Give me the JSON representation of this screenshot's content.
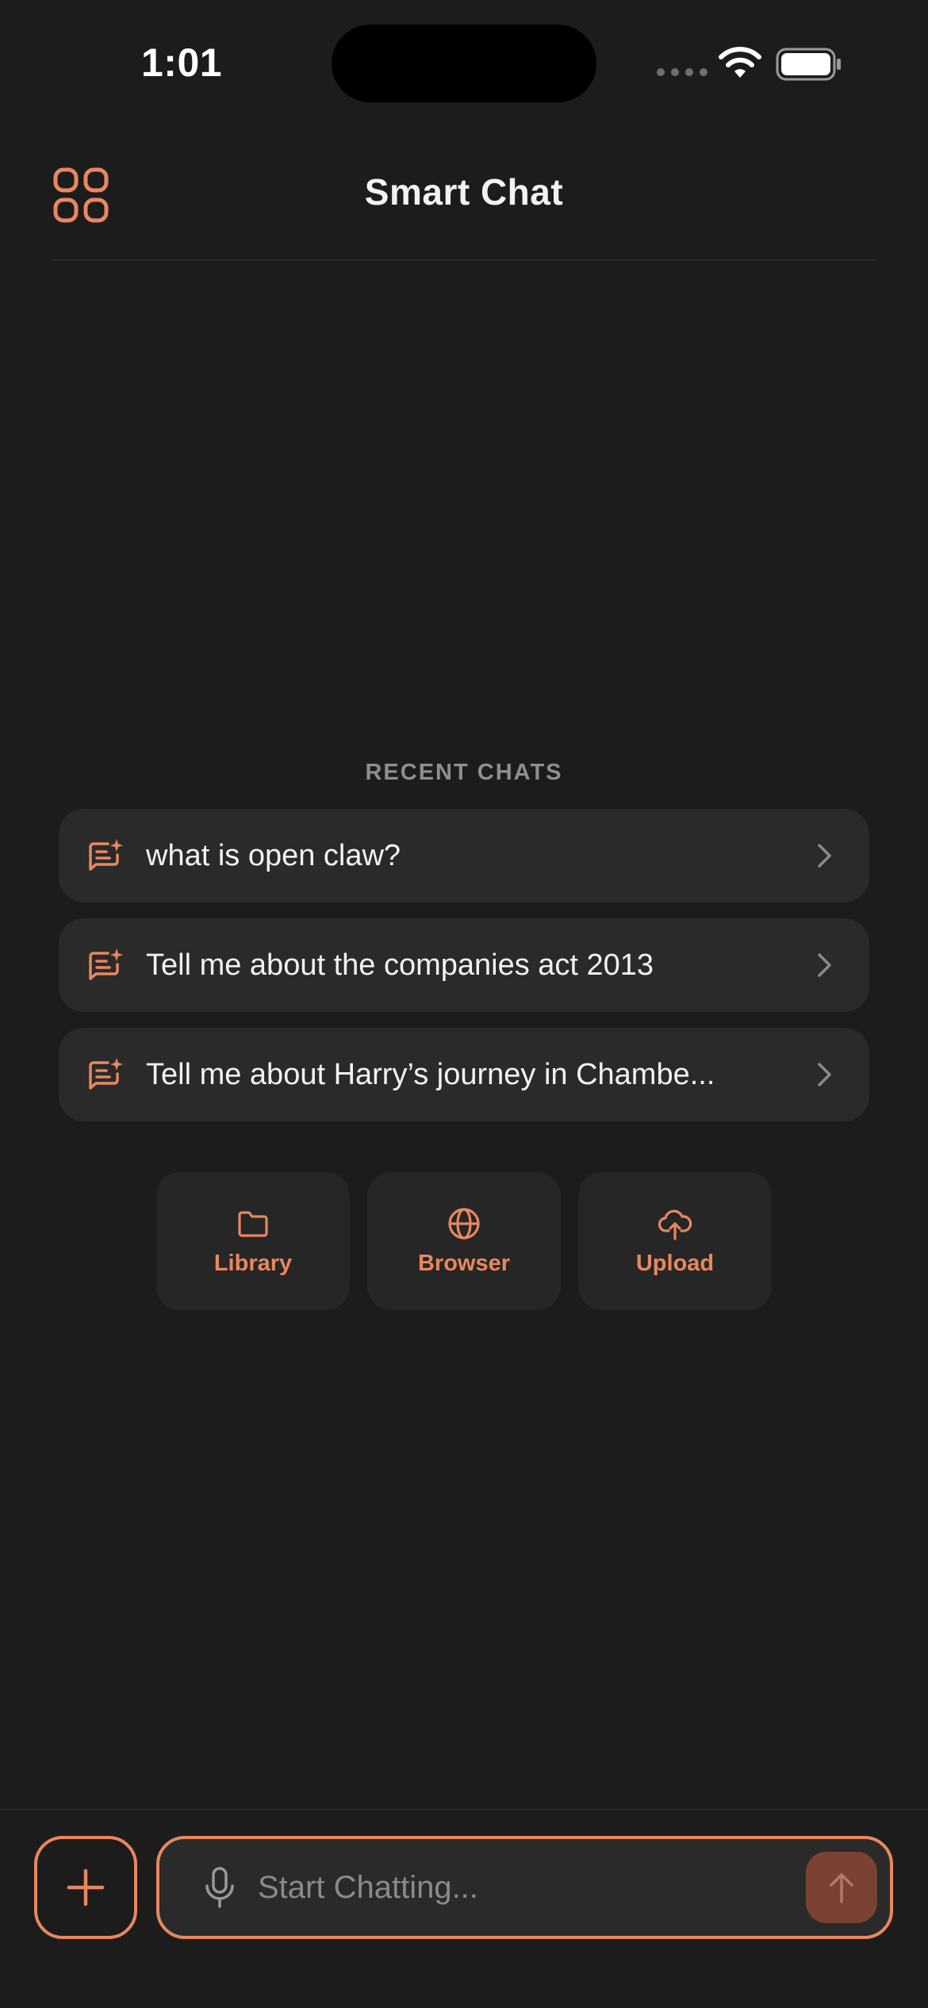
{
  "status_bar": {
    "time": "1:01"
  },
  "header": {
    "title": "Smart Chat",
    "menu_icon": "grid-icon"
  },
  "recent": {
    "label": "RECENT CHATS",
    "items": [
      {
        "text": "what is open claw?",
        "icon": "chat-sparkle-icon"
      },
      {
        "text": "Tell me about the companies act 2013",
        "icon": "chat-sparkle-icon"
      },
      {
        "text": "Tell me about Harry’s journey in Chambe...",
        "icon": "chat-sparkle-icon"
      }
    ]
  },
  "actions": [
    {
      "label": "Library",
      "icon": "folder-icon"
    },
    {
      "label": "Browser",
      "icon": "globe-icon"
    },
    {
      "label": "Upload",
      "icon": "cloud-upload-icon"
    }
  ],
  "composer": {
    "placeholder": "Start Chatting...",
    "value": ""
  },
  "colors": {
    "background": "#1c1c1c",
    "accent": "#e8875f",
    "card": "#2a2a2a",
    "send_button": "#7a4232"
  }
}
